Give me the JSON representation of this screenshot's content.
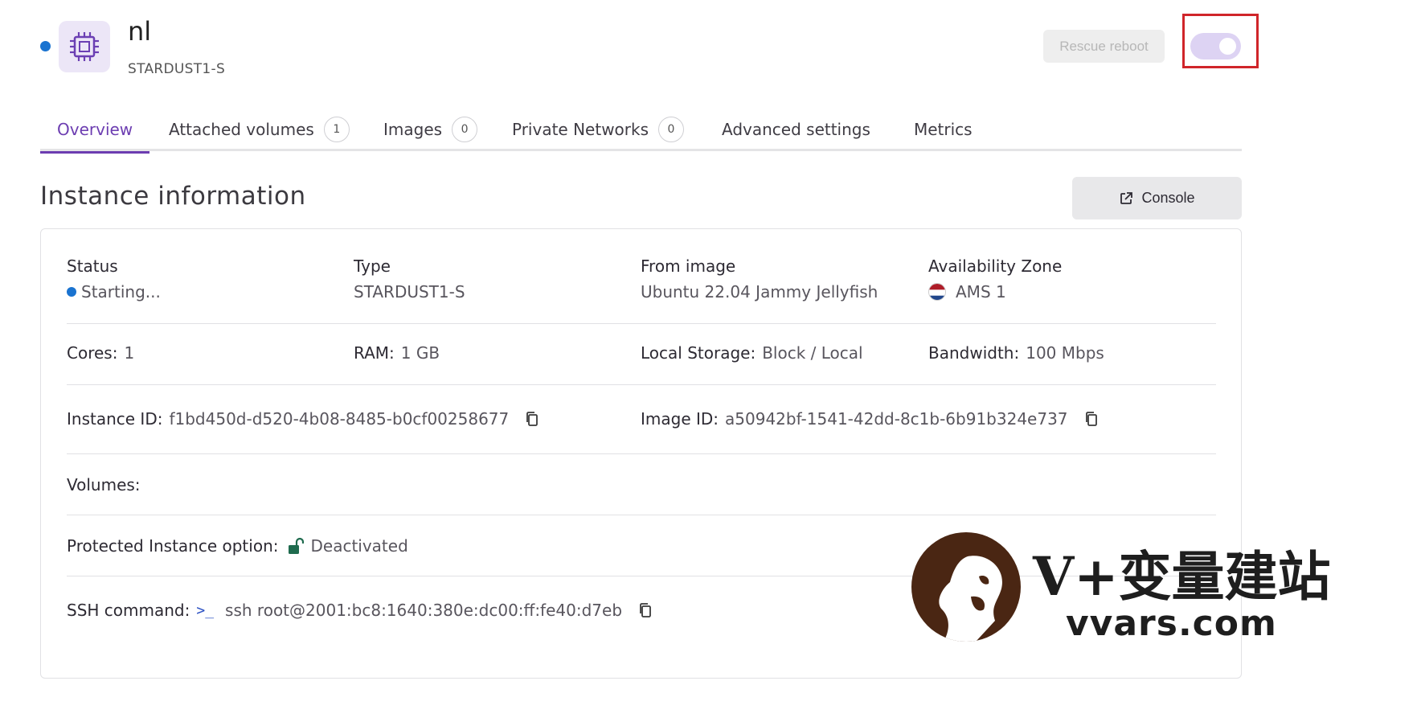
{
  "header": {
    "title": "nl",
    "subtitle": "STARDUST1-S",
    "rescue_label": "Rescue reboot",
    "icon": "cpu-chip-icon",
    "power_toggle": "on"
  },
  "tabs": [
    {
      "label": "Overview",
      "active": true
    },
    {
      "label": "Attached volumes",
      "count": "1"
    },
    {
      "label": "Images",
      "count": "0"
    },
    {
      "label": "Private Networks",
      "count": "0"
    },
    {
      "label": "Advanced settings"
    },
    {
      "label": "Metrics"
    }
  ],
  "section": {
    "title": "Instance information",
    "console_label": "Console"
  },
  "info": {
    "status_label": "Status",
    "status_value": "Starting...",
    "type_label": "Type",
    "type_value": "STARDUST1-S",
    "image_label": "From image",
    "image_value": "Ubuntu 22.04 Jammy Jellyfish",
    "zone_label": "Availability Zone",
    "zone_value": "AMS 1",
    "cores_label": "Cores:",
    "cores_value": "1",
    "ram_label": "RAM:",
    "ram_value": "1 GB",
    "storage_label": "Local Storage:",
    "storage_value": "Block / Local",
    "bandwidth_label": "Bandwidth:",
    "bandwidth_value": "100 Mbps",
    "instance_id_label": "Instance ID:",
    "instance_id_value": "f1bd450d-d520-4b08-8485-b0cf00258677",
    "image_id_label": "Image ID:",
    "image_id_value": "a50942bf-1541-42dd-8c1b-6b91b324e737",
    "volumes_label": "Volumes:",
    "protected_label": "Protected Instance option:",
    "protected_value": "Deactivated",
    "ssh_label": "SSH command:",
    "ssh_prompt": ">_",
    "ssh_value": "ssh root@2001:bc8:1640:380e:dc00:ff:fe40:d7eb"
  },
  "watermark": {
    "line1": "V+变量建站",
    "line2": "vvars.com"
  },
  "colors": {
    "accent": "#6c3db1",
    "status_blue": "#1a73d0",
    "highlight_red": "#d0252a",
    "toggle_bg": "#ddd3f3"
  }
}
